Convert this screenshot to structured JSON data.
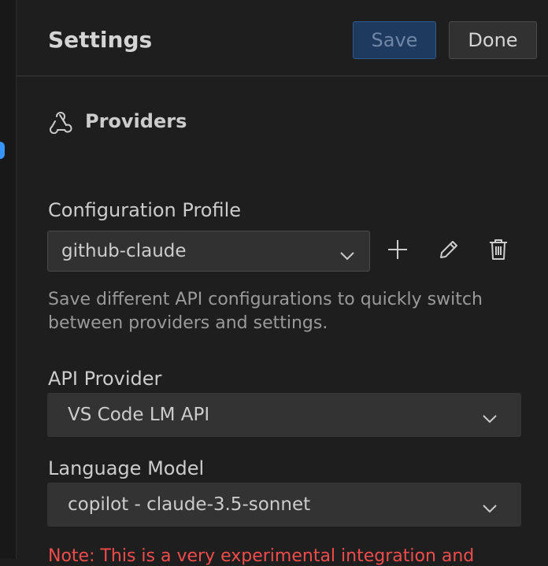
{
  "header": {
    "title": "Settings",
    "save_label": "Save",
    "done_label": "Done"
  },
  "section": {
    "icon": "webhook-icon",
    "title": "Providers"
  },
  "profile": {
    "label": "Configuration Profile",
    "selected": "github-claude",
    "help": "Save different API configurations to quickly switch between providers and settings.",
    "actions": [
      "plus-icon",
      "pencil-icon",
      "trash-icon"
    ]
  },
  "api_provider": {
    "label": "API Provider",
    "selected": "VS Code LM API"
  },
  "language_model": {
    "label": "Language Model",
    "selected": "copilot - claude-3.5-sonnet"
  },
  "note": "Note: This is a very experimental integration and",
  "colors": {
    "background": "#1e1e1e",
    "accent": "#3794ff",
    "warning": "#f14c4c"
  }
}
